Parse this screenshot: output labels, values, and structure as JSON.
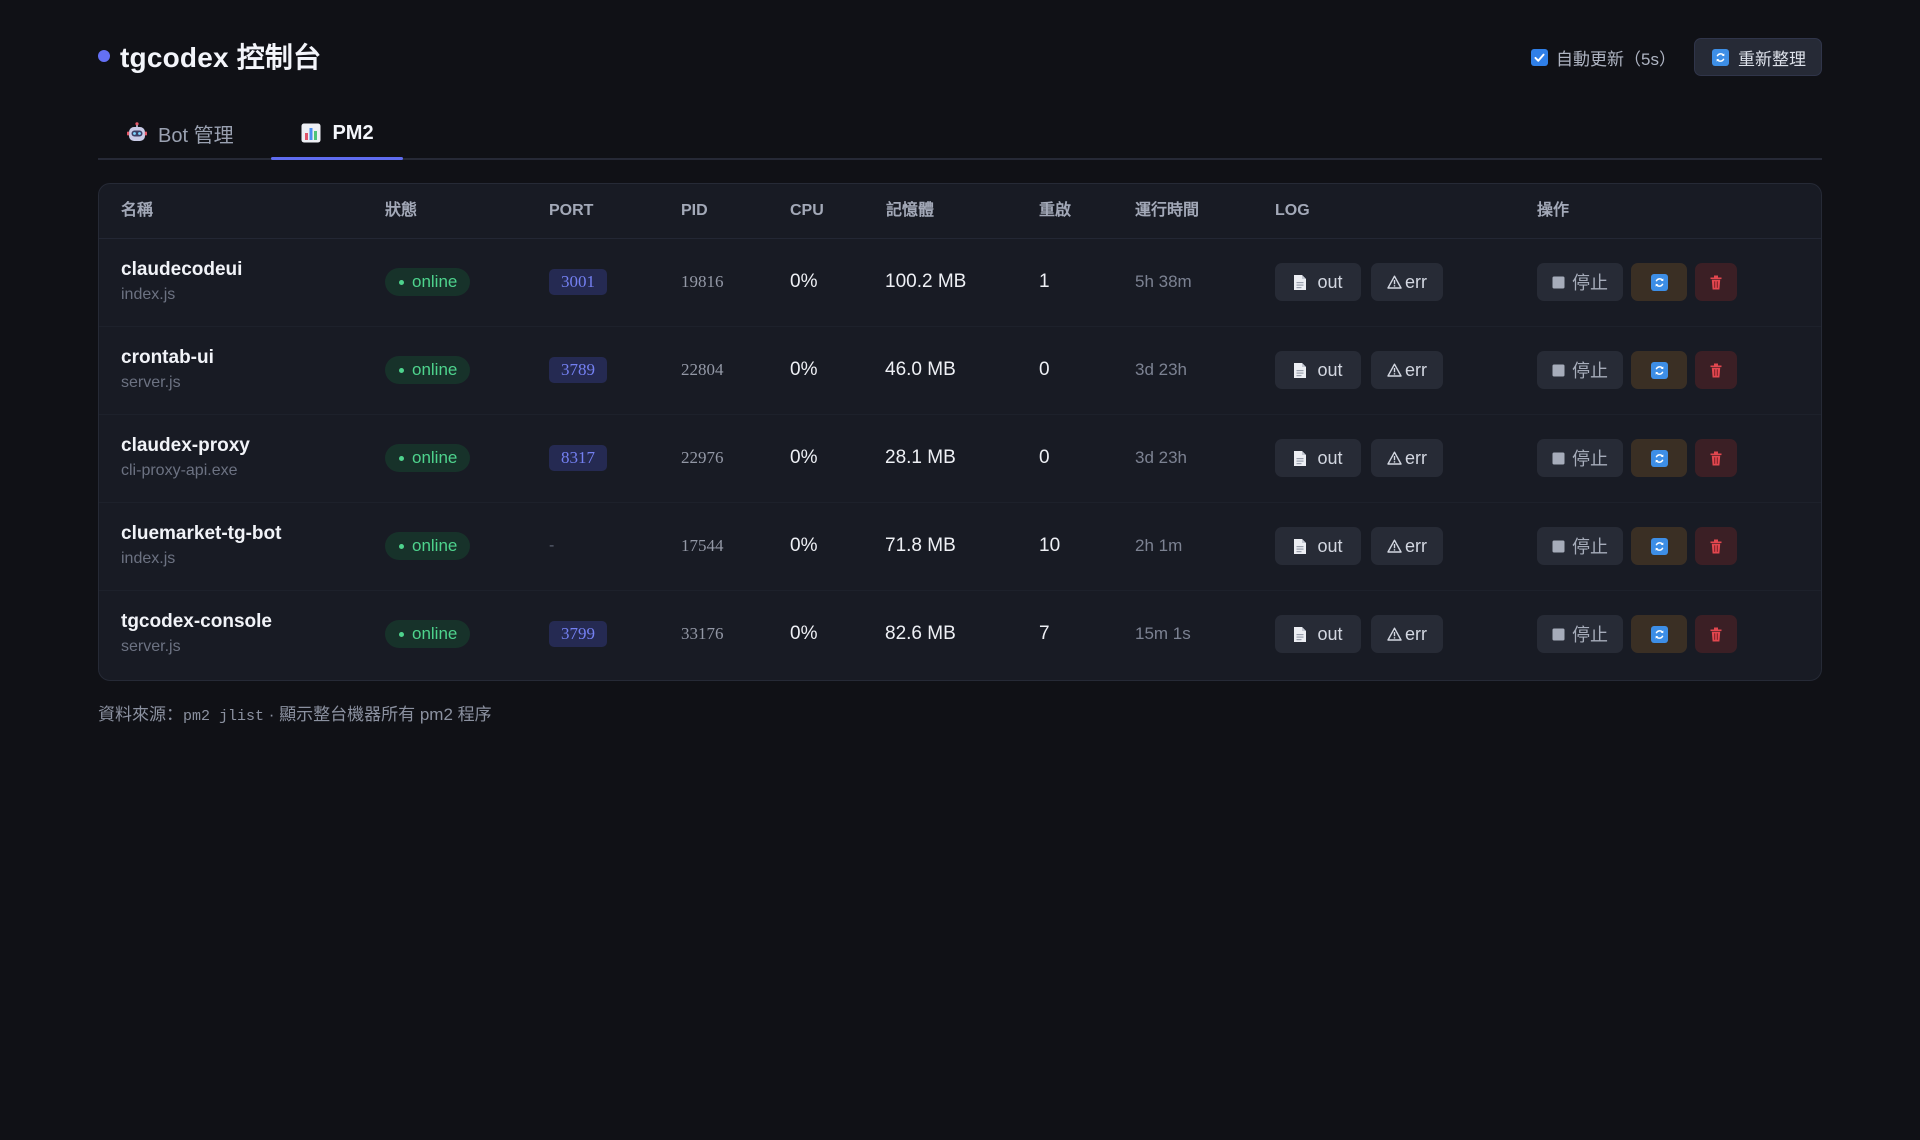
{
  "app": {
    "title": "tgcodex 控制台",
    "accent_color": "#6470f5"
  },
  "header": {
    "auto_refresh_label": "自動更新（5s）",
    "auto_refresh_checked": true,
    "refresh_button_label": "重新整理",
    "refresh_icon": "arrows-refresh-icon"
  },
  "tabs": [
    {
      "label": "Bot 管理",
      "icon": "robot-icon",
      "active": false
    },
    {
      "label": "PM2",
      "icon": "bar-chart-icon",
      "active": true
    }
  ],
  "table": {
    "headers": [
      "名稱",
      "狀態",
      "PORT",
      "PID",
      "CPU",
      "記憶體",
      "重啟",
      "運行時間",
      "LOG",
      "操作"
    ],
    "rows": [
      {
        "name": "claudecodeui",
        "script": "index.js",
        "status": "online",
        "port": "3001",
        "pid": "19816",
        "cpu": "0%",
        "memory": "100.2 MB",
        "restarts": "1",
        "uptime": "5h 38m"
      },
      {
        "name": "crontab-ui",
        "script": "server.js",
        "status": "online",
        "port": "3789",
        "pid": "22804",
        "cpu": "0%",
        "memory": "46.0 MB",
        "restarts": "0",
        "uptime": "3d 23h"
      },
      {
        "name": "claudex-proxy",
        "script": "cli-proxy-api.exe",
        "status": "online",
        "port": "8317",
        "pid": "22976",
        "cpu": "0%",
        "memory": "28.1 MB",
        "restarts": "0",
        "uptime": "3d 23h"
      },
      {
        "name": "cluemarket-tg-bot",
        "script": "index.js",
        "status": "online",
        "port": "-",
        "pid": "17544",
        "cpu": "0%",
        "memory": "71.8 MB",
        "restarts": "10",
        "uptime": "2h 1m"
      },
      {
        "name": "tgcodex-console",
        "script": "server.js",
        "status": "online",
        "port": "3799",
        "pid": "33176",
        "cpu": "0%",
        "memory": "82.6 MB",
        "restarts": "7",
        "uptime": "15m 1s"
      }
    ],
    "log_buttons": {
      "out": "out",
      "err": "err"
    },
    "actions": {
      "stop": "停止"
    }
  },
  "footer": {
    "prefix": "資料來源：",
    "command": "pm2 jlist",
    "suffix": "· 顯示整台機器所有 pm2 程序"
  },
  "colors": {
    "background": "#101116",
    "card": "#181b24",
    "online": "#4ed38d",
    "port": "#7480f2"
  }
}
